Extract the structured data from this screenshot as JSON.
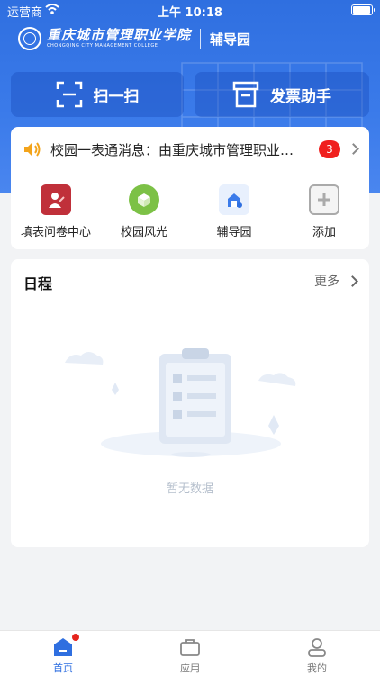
{
  "status_bar": {
    "carrier": "运营商",
    "time": "上午 10:18"
  },
  "header": {
    "school_name_cn": "重庆城市管理职业学院",
    "school_name_en": "CHONGQING CITY MANAGEMENT COLLEGE",
    "module_name": "辅导园"
  },
  "quick_actions": {
    "scan_label": "扫一扫",
    "invoice_label": "发票助手"
  },
  "notice": {
    "text": "校园一表通消息：由重庆城市管理职业学院",
    "badge_count": "3"
  },
  "apps": [
    {
      "label": "填表问卷中心",
      "icon": "form-icon"
    },
    {
      "label": "校园风光",
      "icon": "campus-scenery-icon"
    },
    {
      "label": "辅导园",
      "icon": "counseling-icon"
    },
    {
      "label": "添加",
      "icon": "plus-icon"
    }
  ],
  "schedule": {
    "title": "日程",
    "more_label": "更多",
    "empty_text": "暂无数据"
  },
  "tabbar": [
    {
      "label": "首页",
      "icon": "home-icon",
      "active": true
    },
    {
      "label": "应用",
      "icon": "briefcase-icon",
      "active": false
    },
    {
      "label": "我的",
      "icon": "user-icon",
      "active": false
    }
  ],
  "colors": {
    "primary": "#2f6fe0",
    "badge": "#f0201e"
  }
}
